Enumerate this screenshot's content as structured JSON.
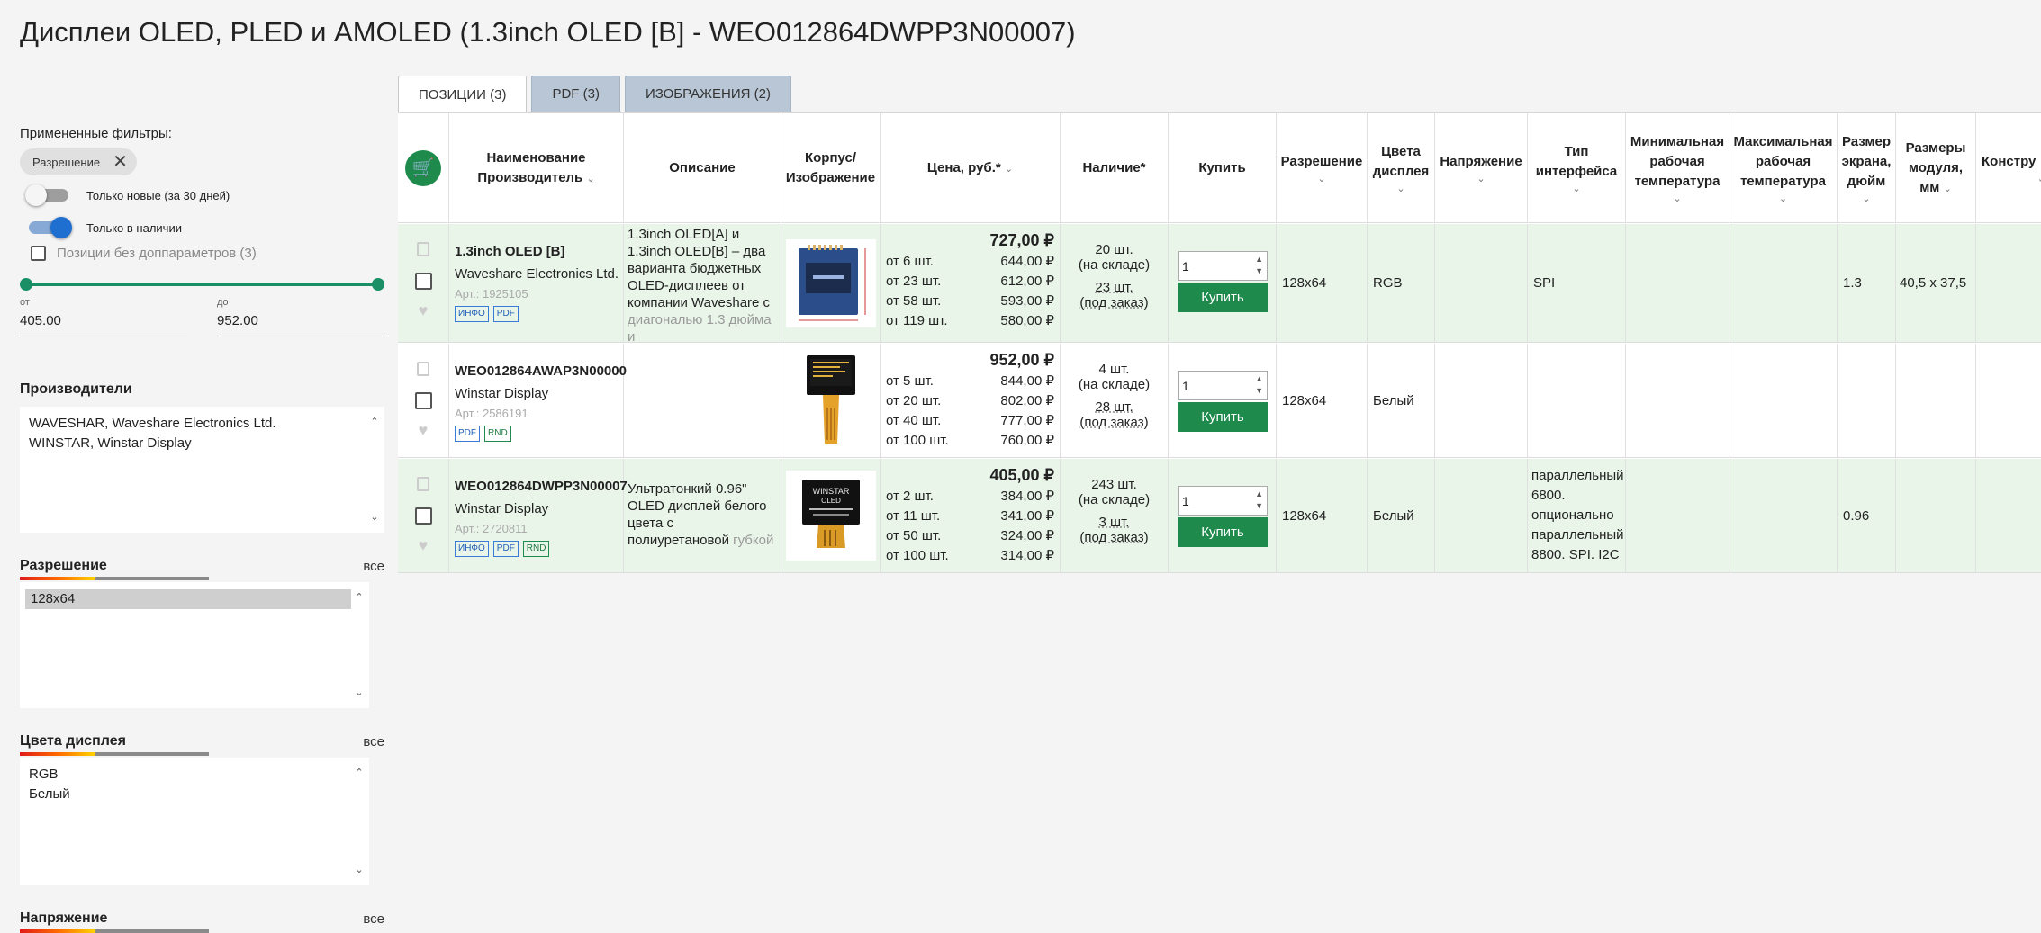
{
  "page_title": "Дисплеи OLED, PLED и AMOLED (1.3inch OLED [B] - WEO012864DWPP3N00007)",
  "filters": {
    "applied_label": "Примененные фильтры:",
    "applied_chip": "Разрешение",
    "toggle_new": "Только новые (за 30 дней)",
    "toggle_new_on": false,
    "toggle_stock": "Только в наличии",
    "toggle_stock_on": true,
    "no_params": "Позиции без доппараметров (3)",
    "price_from_label": "от",
    "price_to_label": "до",
    "price_from": "405.00",
    "price_to": "952.00",
    "manufacturers_title": "Производители",
    "manufacturers": [
      "WAVESHAR, Waveshare Electronics Ltd.",
      "WINSTAR, Winstar Display"
    ],
    "resolution_title": "Разрешение",
    "resolution_options": [
      "128x64"
    ],
    "colors_title": "Цвета дисплея",
    "colors_options": [
      "RGB",
      "Белый"
    ],
    "voltage_title": "Напряжение",
    "all_label": "все"
  },
  "tabs": [
    "ПОЗИЦИИ (3)",
    "PDF (3)",
    "ИЗОБРАЖЕНИЯ (2)"
  ],
  "columns": {
    "name": "Наименование",
    "manufacturer": "Производитель",
    "description": "Описание",
    "case_line1": "Корпус/",
    "case_line2": "Изображение",
    "price": "Цена, руб.*",
    "stock": "Наличие*",
    "buy": "Купить",
    "resolution": "Разрешение",
    "colors": "Цвета дисплея",
    "voltage": "Напряжение",
    "interface": "Тип интерфейса",
    "min_temp": "Минимальная рабочая температура",
    "max_temp": "Максимальная рабочая температура",
    "screen_size": "Размер экрана, дюйм",
    "module_size_line1": "Размеры модуля,",
    "module_size_line2": "мм",
    "construction": "Констру"
  },
  "buy_label": "Купить",
  "badge_info": "ИНФО",
  "badge_pdf": "PDF",
  "badge_rnd": "RND",
  "rows": [
    {
      "part": "1.3inch OLED [B]",
      "maker": "Waveshare Electronics Ltd.",
      "art": "Арт.: 1925105",
      "desc": "1.3inch OLED[A] и 1.3inch OLED[B] – два варианта бюджетных OLED-дисплеев от компании Waveshare с",
      "desc_fade": "диагональю 1.3 дюйма и",
      "price": "727,00 ₽",
      "tiers": [
        [
          "от 6 шт.",
          "644,00 ₽"
        ],
        [
          "от 23 шт.",
          "612,00 ₽"
        ],
        [
          "от 58 шт.",
          "593,00 ₽"
        ],
        [
          "от 119 шт.",
          "580,00 ₽"
        ]
      ],
      "stock1": "20 шт.",
      "stock1_note": "(на складе)",
      "stock2": "23 шт.",
      "stock2_note": "(под заказ)",
      "qty": "1",
      "resolution": "128x64",
      "color": "RGB",
      "interface": "SPI",
      "screen": "1.3",
      "module": "40,5 x 37,5"
    },
    {
      "part": "WEO012864AWAP3N00000",
      "maker": "Winstar Display",
      "art": "Арт.: 2586191",
      "price": "952,00 ₽",
      "tiers": [
        [
          "от 5 шт.",
          "844,00 ₽"
        ],
        [
          "от 20 шт.",
          "802,00 ₽"
        ],
        [
          "от 40 шт.",
          "777,00 ₽"
        ],
        [
          "от 100 шт.",
          "760,00 ₽"
        ]
      ],
      "stock1": "4 шт.",
      "stock1_note": "(на складе)",
      "stock2": "28 шт.",
      "stock2_note": "(под заказ)",
      "qty": "1",
      "resolution": "128x64",
      "color": "Белый"
    },
    {
      "part": "WEO012864DWPP3N00007",
      "maker": "Winstar Display",
      "art": "Арт.: 2720811",
      "desc": "Ультратонкий 0.96\" OLED дисплей белого цвета с полиуретановой",
      "desc_fade": "губкой",
      "price": "405,00 ₽",
      "tiers": [
        [
          "от 2 шт.",
          "384,00 ₽"
        ],
        [
          "от 11 шт.",
          "341,00 ₽"
        ],
        [
          "от 50 шт.",
          "324,00 ₽"
        ],
        [
          "от 100 шт.",
          "314,00 ₽"
        ]
      ],
      "stock1": "243 шт.",
      "stock1_note": "(на складе)",
      "stock2": "3 шт.",
      "stock2_note": "(под заказ)",
      "qty": "1",
      "resolution": "128x64",
      "color": "Белый",
      "interface_lines": [
        "параллельный",
        "6800.",
        "опционально",
        "параллельный",
        "8800. SPI. I2C"
      ],
      "screen": "0.96"
    }
  ],
  "oled_labels": {
    "winstar_line1": "WINSTAR",
    "winstar_line2": "OLED"
  },
  "colors": {
    "accent_green": "#1e8a4c",
    "row_green": "#e9f5e9",
    "tab_inactive": "#b8c6d6",
    "toggle_blue": "#1f6fd1"
  }
}
